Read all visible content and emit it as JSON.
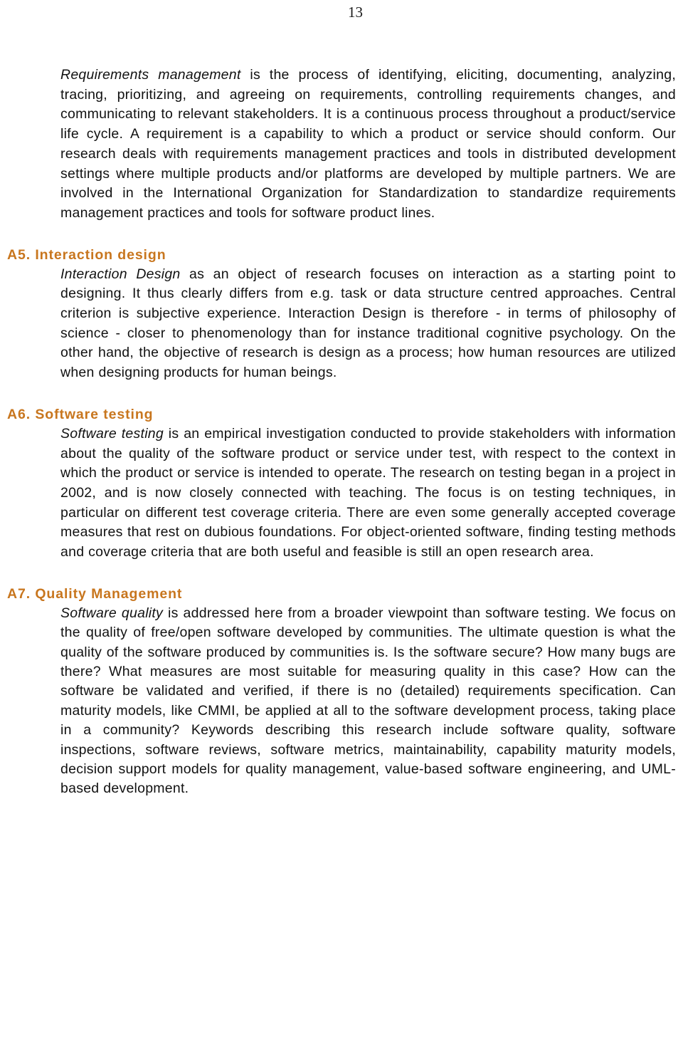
{
  "page": {
    "number": "13"
  },
  "sections": [
    {
      "id": "requirements-management",
      "heading": null,
      "paragraph_lead_italic": "Requirements management",
      "paragraph_rest": " is the process of identifying, eliciting, documenting, analyzing, tracing, prioritizing, and agreeing on requirements, controlling requirements changes, and communicating to relevant stakeholders. It is a continuous process throughout a product/service life cycle. A requirement is a capability to which a product or service should conform. Our research deals with requirements management practices and tools in distributed development settings where multiple products and/or platforms are developed by multiple partners. We are involved in the International Organization for Standardization to standardize requirements management practices and tools for software product lines."
    },
    {
      "id": "interaction-design",
      "heading": "A5. Interaction design",
      "paragraph_lead_italic": "Interaction Design",
      "paragraph_rest": " as an object of research focuses on interaction as a starting point to designing. It thus clearly differs from e.g. task or data structure centred approaches. Central criterion is subjective experience. Interaction Design is therefore - in terms of philosophy of science - closer to phenomenology than for instance traditional cognitive psychology. On the other hand, the objective of research is design as a process; how human resources are utilized when designing products for human beings."
    },
    {
      "id": "software-testing",
      "heading": "A6. Software testing",
      "paragraph_lead_italic": "Software testing",
      "paragraph_rest": " is an empirical investigation conducted to provide stakeholders with information about the quality of the software product or service under test, with respect to the context in which the product or service is intended to operate. The research on testing began in a project in 2002, and is now closely connected with teaching. The focus is on testing techniques, in particular on different test coverage criteria. There are even some generally accepted coverage measures that rest on dubious foundations. For object-oriented software, finding testing methods and coverage criteria that are both useful and feasible is still an open research area."
    },
    {
      "id": "quality-management",
      "heading": "A7. Quality Management",
      "paragraph_lead_italic": "Software quality",
      "paragraph_rest": " is addressed here from a broader viewpoint than software testing. We focus on the quality of free/open software developed by communities. The ultimate question is what the quality of the software produced by communities is. Is the software secure? How many bugs are there? What measures are most suitable for measuring quality in this case? How can the software be validated and verified, if there is no (detailed) requirements specification. Can maturity models, like CMMI, be applied at all to the software development process, taking place in a community? Keywords describing this research include software quality, software inspections, software reviews, software metrics, maintainability, capability maturity models, decision support models for quality management, value-based software engineering, and UML-based development."
    }
  ],
  "colors": {
    "heading": "#c8761e",
    "body_text": "#111111",
    "page_background": "#ffffff"
  }
}
